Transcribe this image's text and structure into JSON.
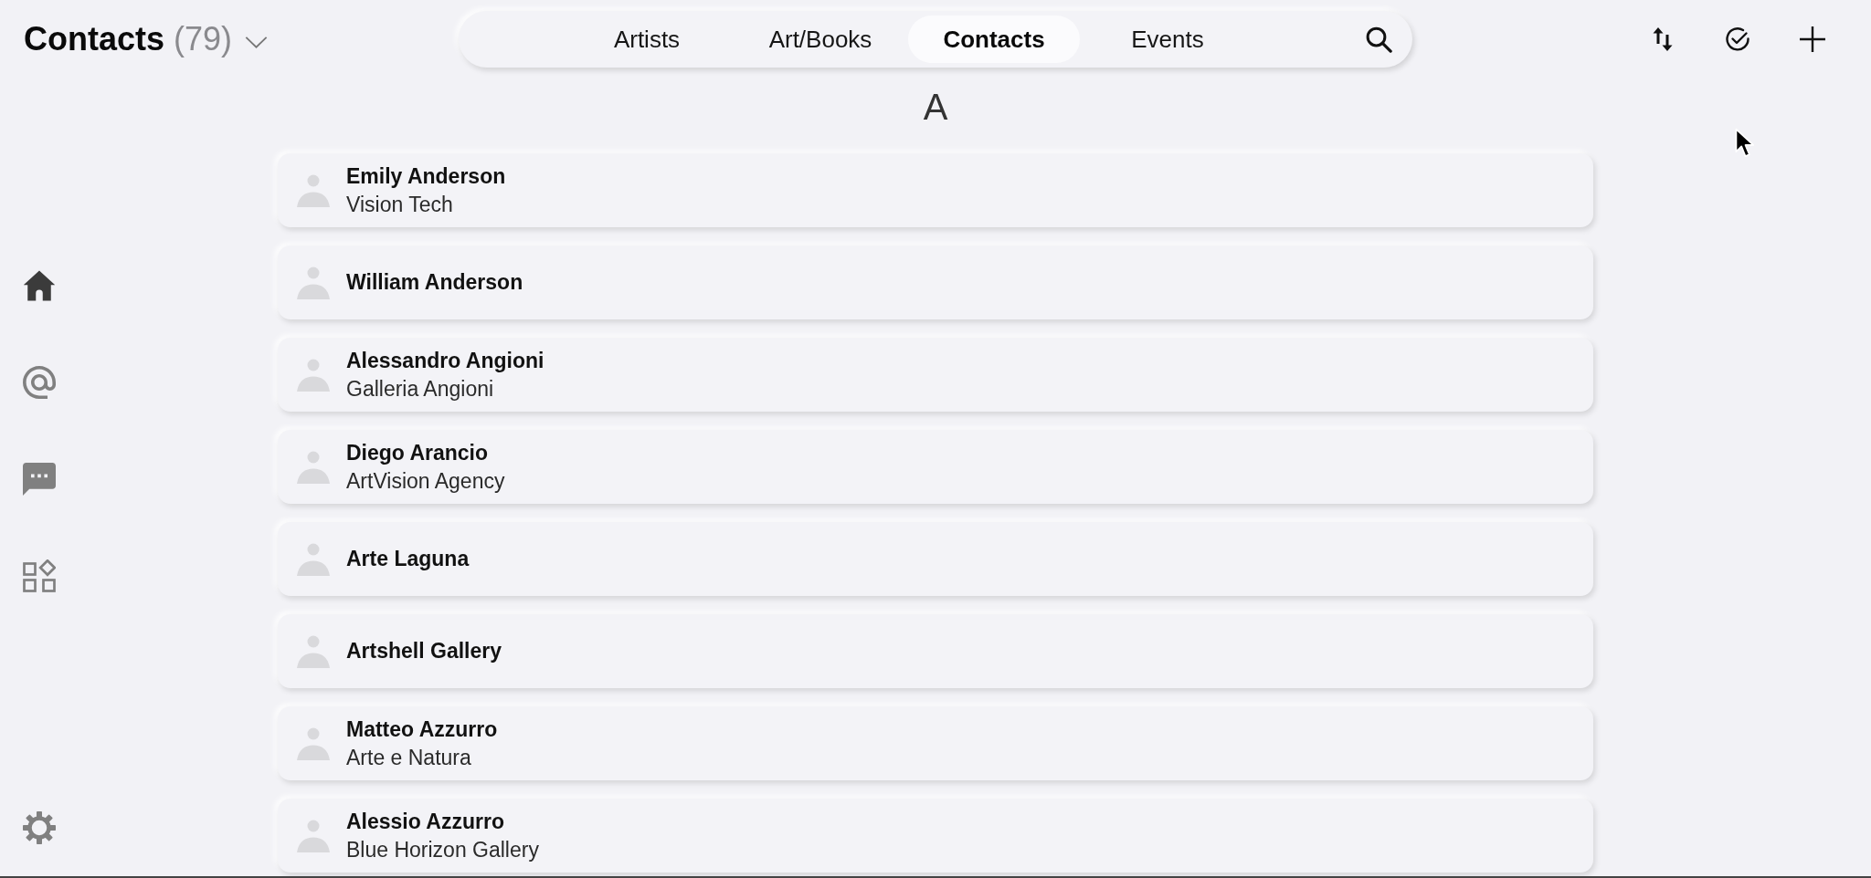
{
  "header": {
    "title": "Contacts",
    "count": "(79)"
  },
  "tabs": [
    {
      "label": "Artists",
      "selected": false
    },
    {
      "label": "Art/Books",
      "selected": false
    },
    {
      "label": "Contacts",
      "selected": true
    },
    {
      "label": "Events",
      "selected": false
    }
  ],
  "sidebar": {
    "items": [
      {
        "kind": "home",
        "selected": true
      },
      {
        "kind": "mentions",
        "selected": false
      },
      {
        "kind": "messages",
        "selected": false
      },
      {
        "kind": "apps",
        "selected": false
      },
      {
        "kind": "settings",
        "selected": false
      }
    ]
  },
  "sections": [
    {
      "letter": "A",
      "contacts": [
        {
          "name": "Emily Anderson",
          "company": "Vision Tech"
        },
        {
          "name": "William Anderson"
        },
        {
          "name": "Alessandro Angioni",
          "company": "Galleria Angioni"
        },
        {
          "name": "Diego Arancio",
          "company": "ArtVision Agency"
        },
        {
          "name": "Arte Laguna"
        },
        {
          "name": "Artshell Gallery"
        },
        {
          "name": "Matteo Azzurro",
          "company": "Arte e Natura"
        },
        {
          "name": "Alessio Azzurro",
          "company": "Blue Horizon Gallery"
        }
      ]
    }
  ]
}
